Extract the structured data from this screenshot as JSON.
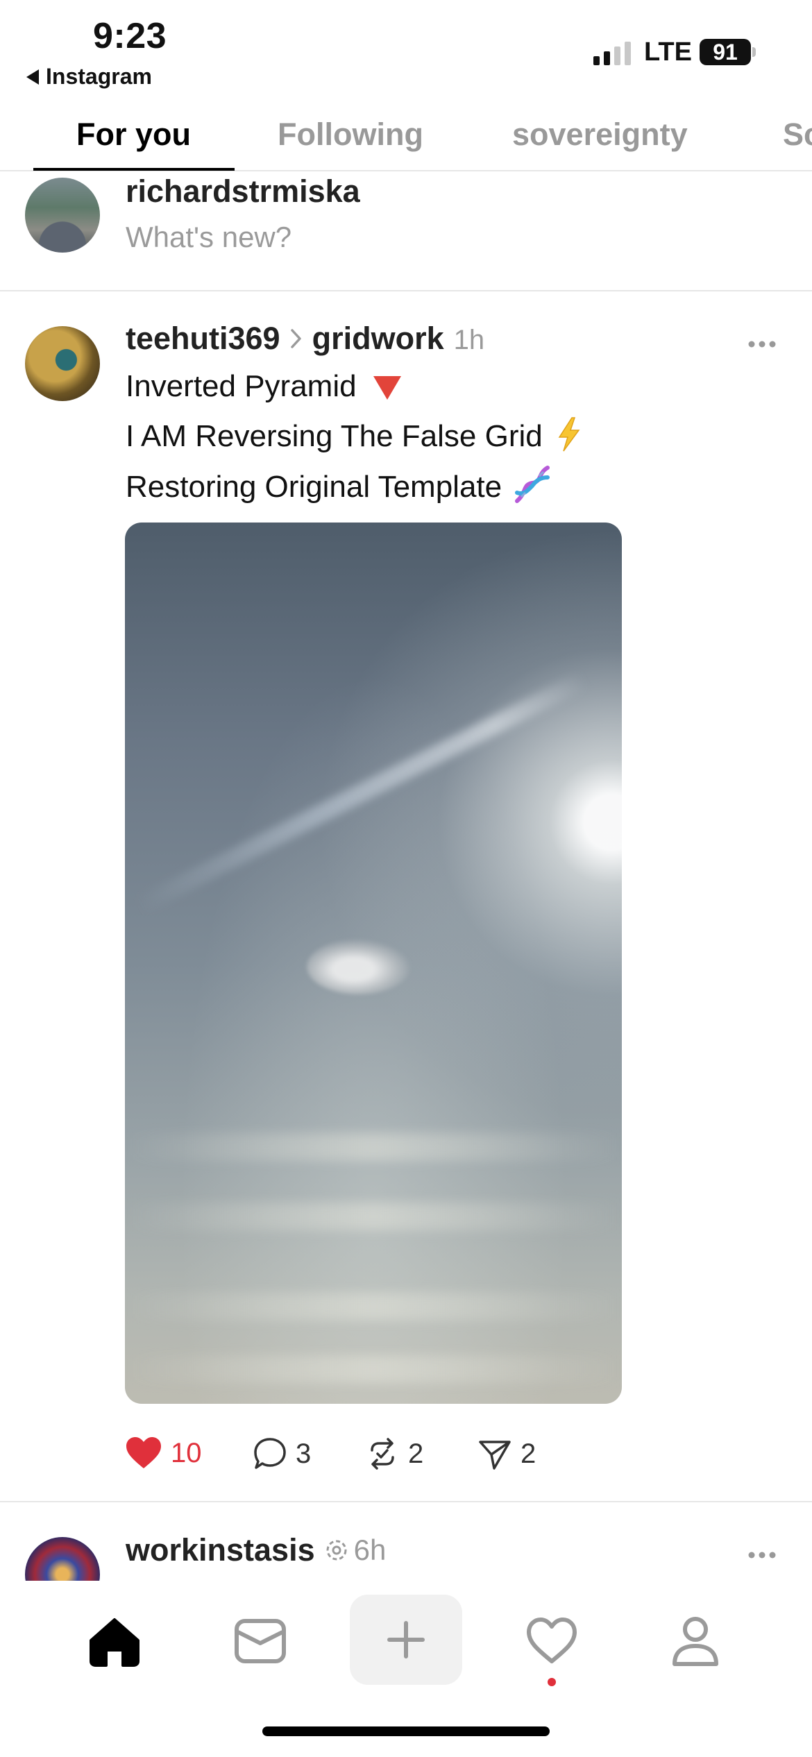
{
  "status_bar": {
    "time": "9:23",
    "back_app": "Instagram",
    "network": "LTE",
    "battery": "91"
  },
  "tabs": [
    {
      "label": "For you",
      "active": true
    },
    {
      "label": "Following",
      "active": false
    },
    {
      "label": "sovereignty",
      "active": false
    },
    {
      "label": "Sc",
      "active": false
    }
  ],
  "composer": {
    "username": "richardstrmiska",
    "prompt": "What's new?"
  },
  "post": {
    "username": "teehuti369",
    "separator_icon": "chevron-right-icon",
    "community": "gridwork",
    "time": "1h",
    "lines": [
      "Inverted Pyramid",
      "I AM Reversing The False Grid",
      "Restoring Original Template"
    ],
    "line_emojis": [
      "red-triangle-down-emoji",
      "lightning-emoji",
      "dna-emoji"
    ],
    "image_alt_icon": "sky-photo",
    "likes": "10",
    "comments": "3",
    "reposts": "2",
    "shares": "2",
    "liked": true
  },
  "next_post": {
    "username": "workinstasis",
    "time": "6h"
  },
  "tab_bar": {
    "items": [
      "home-icon",
      "inbox-icon",
      "create-icon",
      "activity-icon",
      "profile-icon"
    ]
  },
  "colors": {
    "accent_red": "#e0303b",
    "muted_text": "#9a9a9a",
    "divider": "#e6e6e6"
  }
}
